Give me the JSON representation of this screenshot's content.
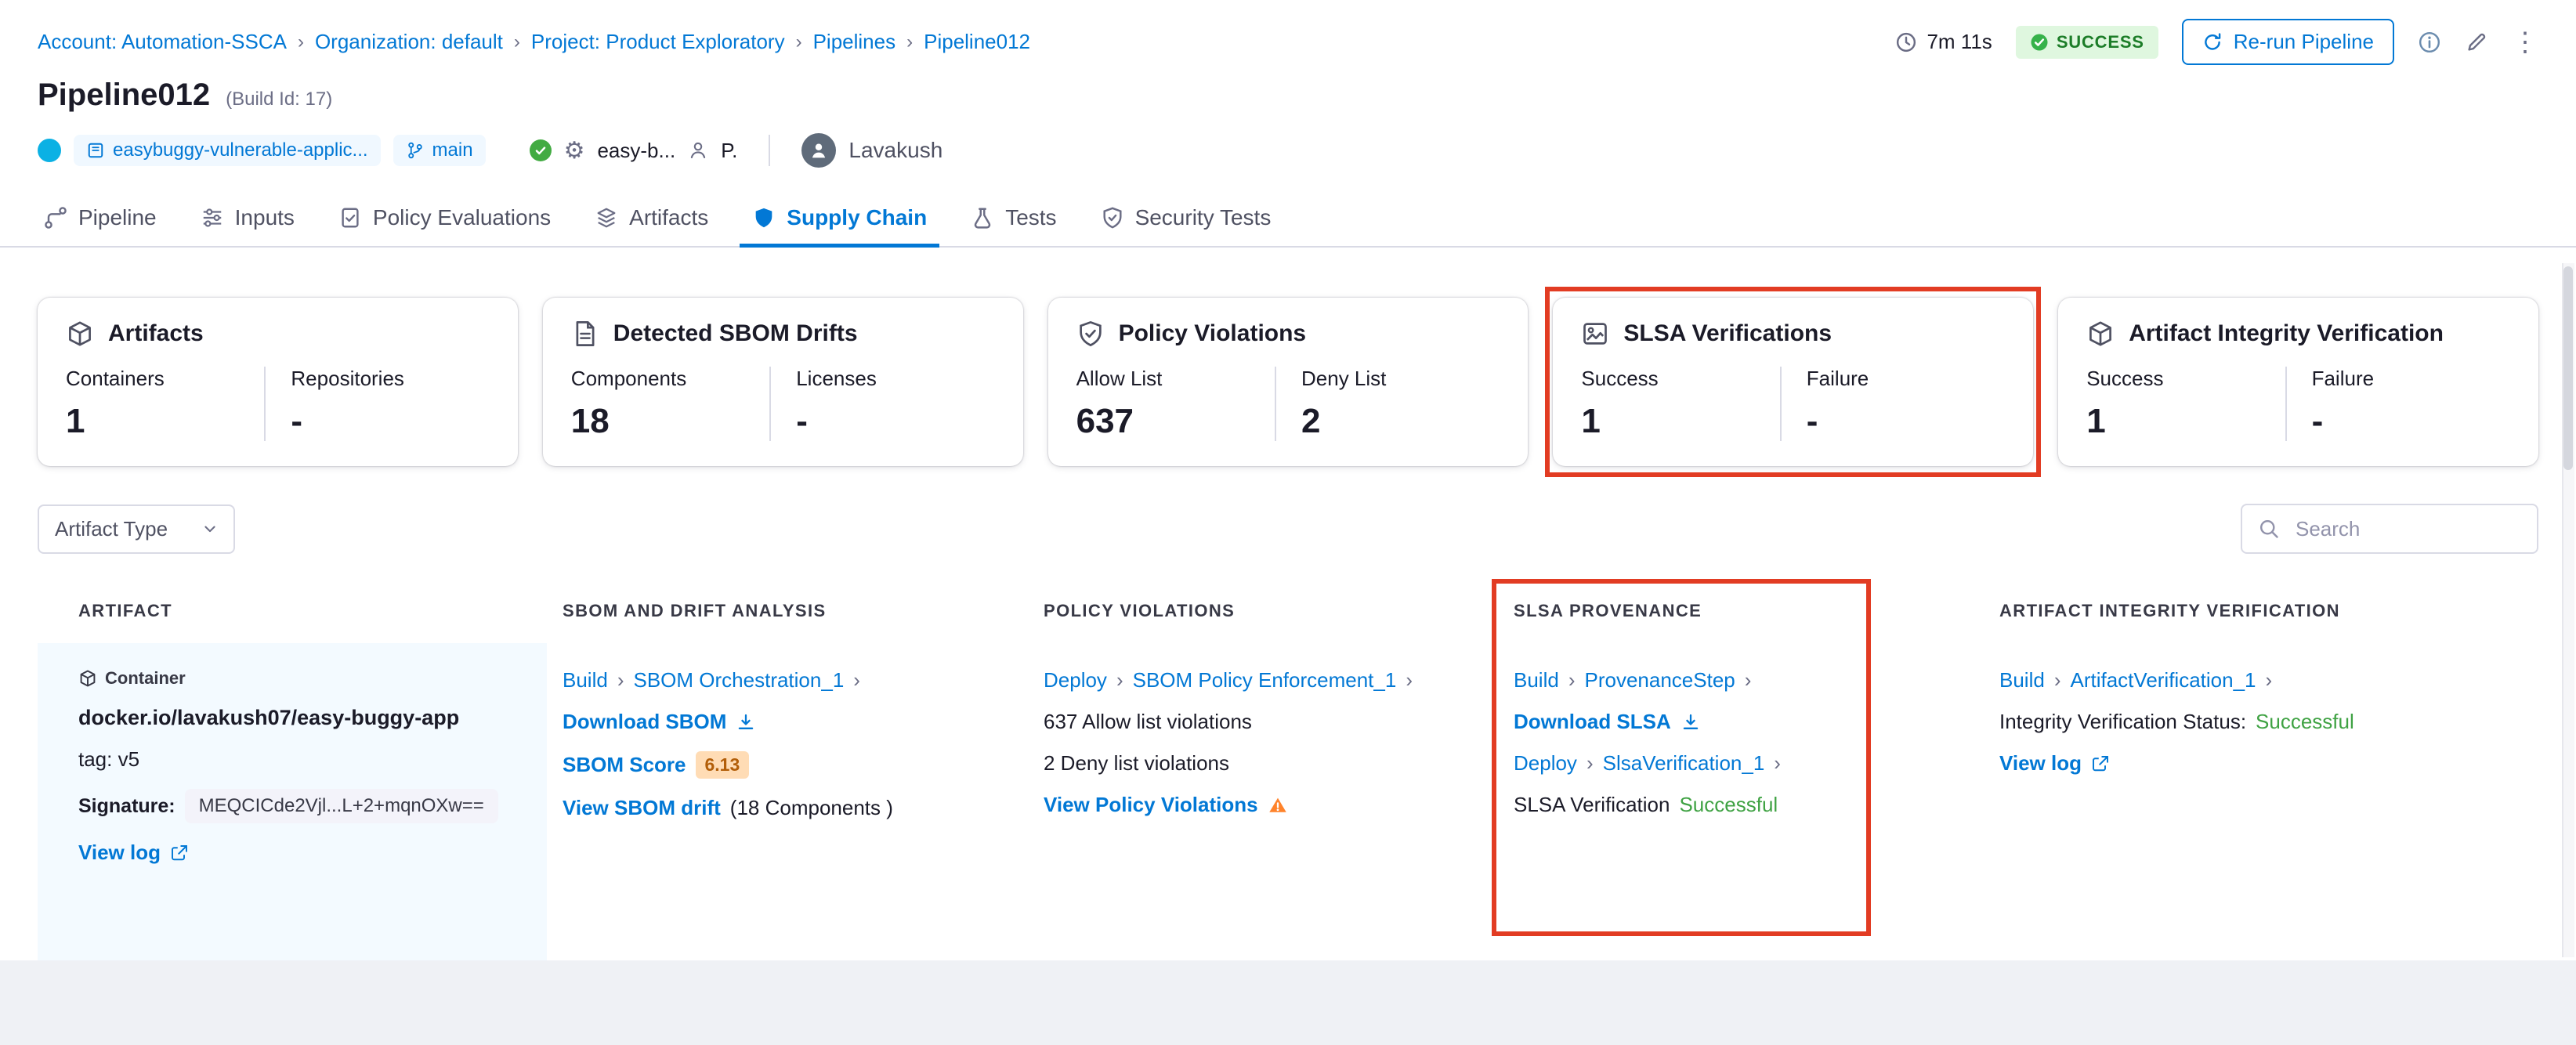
{
  "breadcrumb": {
    "items": [
      "Account: Automation-SSCA",
      "Organization: default",
      "Project: Product Exploratory",
      "Pipelines",
      "Pipeline012"
    ]
  },
  "topbar": {
    "duration": "7m 11s",
    "status": "SUCCESS",
    "rerun_label": "Re-run Pipeline"
  },
  "header": {
    "title": "Pipeline012",
    "build_id": "(Build Id: 17)",
    "repo": "easybuggy-vulnerable-applic...",
    "branch": "main",
    "environment": "easy-b...",
    "project_initial": "P.",
    "user": "Lavakush"
  },
  "tabs": [
    {
      "label": "Pipeline"
    },
    {
      "label": "Inputs"
    },
    {
      "label": "Policy Evaluations"
    },
    {
      "label": "Artifacts"
    },
    {
      "label": "Supply Chain",
      "active": true
    },
    {
      "label": "Tests"
    },
    {
      "label": "Security Tests"
    }
  ],
  "cards": [
    {
      "title": "Artifacts",
      "stats": [
        {
          "label": "Containers",
          "value": "1"
        },
        {
          "label": "Repositories",
          "value": "-"
        }
      ]
    },
    {
      "title": "Detected SBOM Drifts",
      "stats": [
        {
          "label": "Components",
          "value": "18"
        },
        {
          "label": "Licenses",
          "value": "-"
        }
      ]
    },
    {
      "title": "Policy Violations",
      "stats": [
        {
          "label": "Allow List",
          "value": "637"
        },
        {
          "label": "Deny List",
          "value": "2"
        }
      ]
    },
    {
      "title": "SLSA Verifications",
      "highlight": true,
      "stats": [
        {
          "label": "Success",
          "value": "1"
        },
        {
          "label": "Failure",
          "value": "-"
        }
      ]
    },
    {
      "title": "Artifact Integrity Verification",
      "stats": [
        {
          "label": "Success",
          "value": "1"
        },
        {
          "label": "Failure",
          "value": "-"
        }
      ]
    }
  ],
  "filters": {
    "artifact_type_label": "Artifact Type",
    "search_placeholder": "Search"
  },
  "table": {
    "headers": [
      "ARTIFACT",
      "SBOM AND DRIFT ANALYSIS",
      "POLICY VIOLATIONS",
      "SLSA PROVENANCE",
      "ARTIFACT INTEGRITY VERIFICATION"
    ],
    "row": {
      "artifact": {
        "type": "Container",
        "image": "docker.io/lavakush07/easy-buggy-app",
        "tag": "tag: v5",
        "signature_label": "Signature:",
        "signature": "MEQCICde2Vjl...L+2+mqnOXw==",
        "view_log": "View log"
      },
      "sbom": {
        "stage": "Build",
        "step": "SBOM Orchestration_1",
        "download": "Download SBOM",
        "score_label": "SBOM Score",
        "score": "6.13",
        "drift_link": "View SBOM drift",
        "drift_note": "(18 Components )"
      },
      "policy": {
        "stage": "Deploy",
        "step": "SBOM Policy Enforcement_1",
        "allow": "637 Allow list violations",
        "deny": "2 Deny list violations",
        "view": "View Policy Violations"
      },
      "slsa": {
        "stage1": "Build",
        "step1": "ProvenanceStep",
        "download": "Download SLSA",
        "stage2": "Deploy",
        "step2": "SlsaVerification_1",
        "status_prefix": "SLSA Verification",
        "status": "Successful"
      },
      "integrity": {
        "stage": "Build",
        "step": "ArtifactVerification_1",
        "status_prefix": "Integrity Verification Status:",
        "status": "Successful",
        "view_log": "View log"
      }
    }
  },
  "colors": {
    "link_blue": "#0278D5",
    "success_badge_bg": "#DFF7DF",
    "success_badge_text": "#1C7D28",
    "success_green": "#3FA243",
    "score_badge_bg": "#FFDCB5",
    "score_badge_text": "#B25E09",
    "warning_orange": "#FF832B",
    "annotation_red": "#E23C23"
  }
}
